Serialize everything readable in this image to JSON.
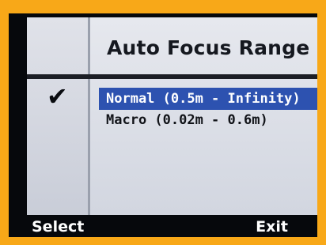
{
  "menu": {
    "title": "Auto Focus Range",
    "check_glyph": "✔",
    "options": [
      {
        "label": "Normal (0.5m - Infinity)",
        "selected": true
      },
      {
        "label": "Macro (0.02m - 0.6m)",
        "selected": false
      }
    ]
  },
  "softkeys": {
    "left_label": "Select",
    "right_label": "Exit"
  },
  "colors": {
    "frame": "#f8a818",
    "highlight": "#2d52b0",
    "screen_bg": "#06080c"
  }
}
